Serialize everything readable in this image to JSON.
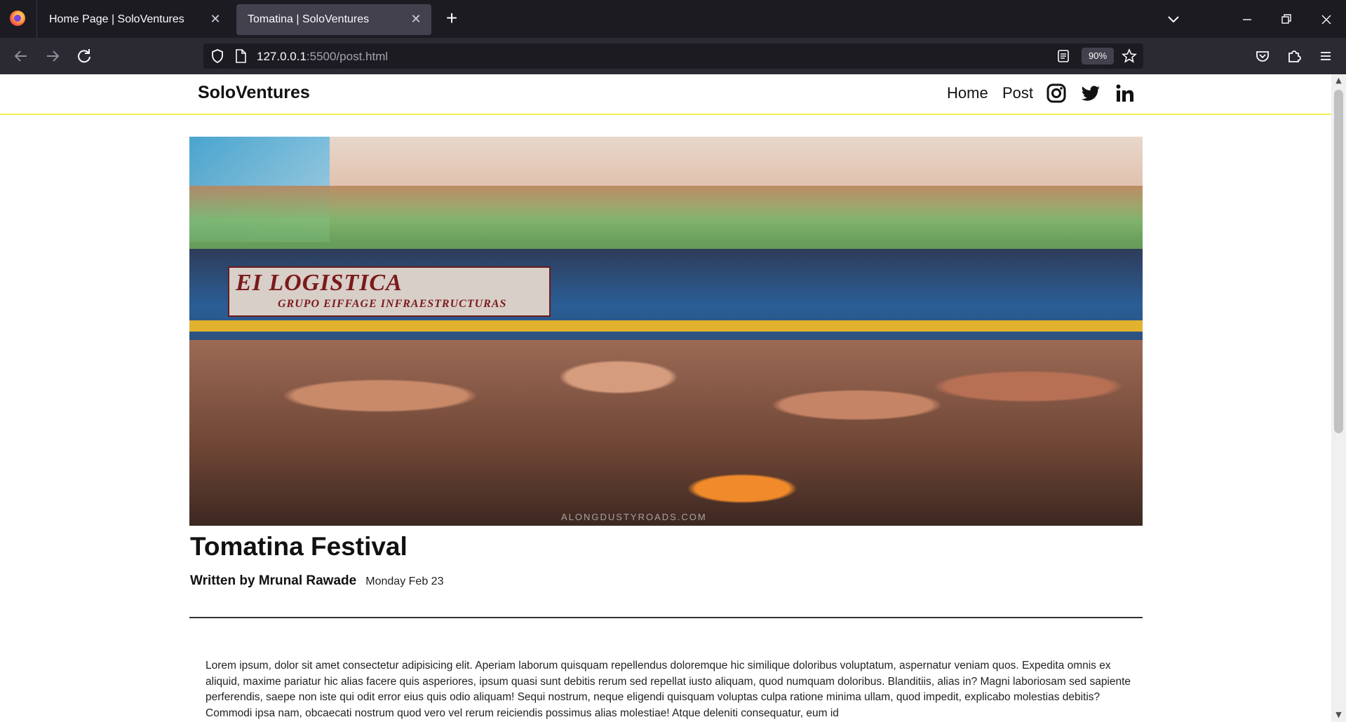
{
  "browser": {
    "tabs": [
      {
        "title": "Home Page | SoloVentures",
        "active": false
      },
      {
        "title": "Tomatina | SoloVentures",
        "active": true
      }
    ],
    "url": {
      "host": "127.0.0.1",
      "rest": ":5500/post.html"
    },
    "zoom": "90%"
  },
  "site": {
    "brand": "SoloVentures",
    "nav": {
      "home": "Home",
      "post": "Post"
    },
    "social_icons": [
      "instagram-icon",
      "twitter-icon",
      "linkedin-icon"
    ],
    "accent_color": "#f5ee4c"
  },
  "post": {
    "hero_watermark": "ALONGDUSTYROADS.COM",
    "hero_sign": {
      "line1": "EI LOGISTICA",
      "line2": "GRUPO EIFFAGE INFRAESTRUCTURAS"
    },
    "title": "Tomatina Festival",
    "author": "Written by Mrunal Rawade",
    "date": "Monday Feb 23",
    "body": "Lorem ipsum, dolor sit amet consectetur adipisicing elit. Aperiam laborum quisquam repellendus doloremque hic similique doloribus voluptatum, aspernatur veniam quos. Expedita omnis ex aliquid, maxime pariatur hic alias facere quis asperiores, ipsum quasi sunt debitis rerum sed repellat iusto aliquam, quod numquam doloribus. Blanditiis, alias in? Magni laboriosam sed sapiente perferendis, saepe non iste qui odit error eius quis odio aliquam! Sequi nostrum, neque eligendi quisquam voluptas culpa ratione minima ullam, quod impedit, explicabo molestias debitis? Commodi ipsa nam, obcaecati nostrum quod vero vel rerum reiciendis possimus alias molestiae! Atque deleniti consequatur, eum id"
  }
}
